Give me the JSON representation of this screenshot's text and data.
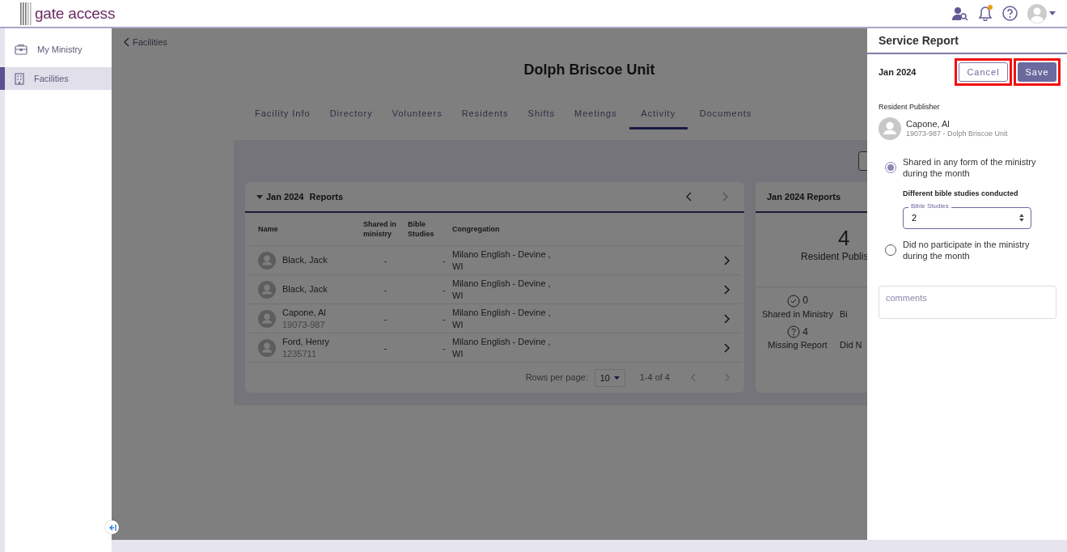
{
  "header": {
    "logo": "gate access",
    "notification_dot": true
  },
  "sidebar": {
    "items": [
      {
        "label": "My Ministry",
        "kind": "briefcase",
        "selected": false
      },
      {
        "label": "Facilities",
        "kind": "building",
        "selected": true
      }
    ]
  },
  "breadcrumb": "Facilities",
  "title": "Dolph Briscoe Unit",
  "tabs": [
    {
      "label": "Facility Info",
      "selected": false
    },
    {
      "label": "Directory",
      "selected": false
    },
    {
      "label": "Volunteers",
      "selected": false
    },
    {
      "label": "Residents",
      "selected": false
    },
    {
      "label": "Shifts",
      "selected": false
    },
    {
      "label": "Meetings",
      "selected": false
    },
    {
      "label": "Activity",
      "selected": true
    },
    {
      "label": "Documents",
      "selected": false
    }
  ],
  "reports": {
    "month": "Jan 2024",
    "word": "Reports",
    "expanded": true,
    "columns": [
      "Name",
      "Shared in ministry",
      "Bible Studies",
      "Congregation"
    ],
    "rows": [
      {
        "name": "Black, Jack",
        "shared": "-",
        "studies": "-",
        "congregation": "Milano English - Devine ,",
        "region": "WI"
      },
      {
        "name": "Black, Jack",
        "shared": "-",
        "studies": "-",
        "congregation": "Milano English - Devine ,",
        "region": "WI"
      },
      {
        "name": "Capone, Al",
        "id": "19073-987",
        "shared": "-",
        "studies": "-",
        "congregation": "Milano English - Devine ,",
        "region": "WI"
      },
      {
        "name": "Ford, Henry",
        "id": "1235711",
        "shared": "-",
        "studies": "-",
        "congregation": "Milano English - Devine ,",
        "region": "WI"
      }
    ],
    "rows_per_page_label": "Rows per page:",
    "rows_per_page": "10",
    "range": "1-4 of 4"
  },
  "summary": {
    "title": "Jan 2024 Reports",
    "total": "4",
    "total_label": "Resident Publis",
    "stats": [
      {
        "kind": "check",
        "count": "0",
        "label": "Shared in Ministry"
      },
      {
        "kind": "plain",
        "label": "Bi"
      },
      {
        "kind": "question",
        "count": "4",
        "label": "Missing Report"
      },
      {
        "kind": "plain",
        "label": "Did N"
      }
    ]
  },
  "drawer": {
    "title": "Service Report",
    "month": "Jan 2024",
    "cancel": "Cancel",
    "save": "Save",
    "highlighted": true,
    "publisher_label": "Resident Publisher",
    "publisher_name": "Capone, Al",
    "publisher_detail": "19073-987 - Dolph Briscoe Unit",
    "options": [
      {
        "label": "Shared in any form of the ministry during the month",
        "selected": true
      },
      {
        "label": "Did no participate in the ministry during the month",
        "selected": false
      }
    ],
    "studies_prompt": "Different bible studies conducted",
    "studies_field": {
      "label": "Bible Studies",
      "value": "2"
    },
    "comments_placeholder": "comments"
  }
}
